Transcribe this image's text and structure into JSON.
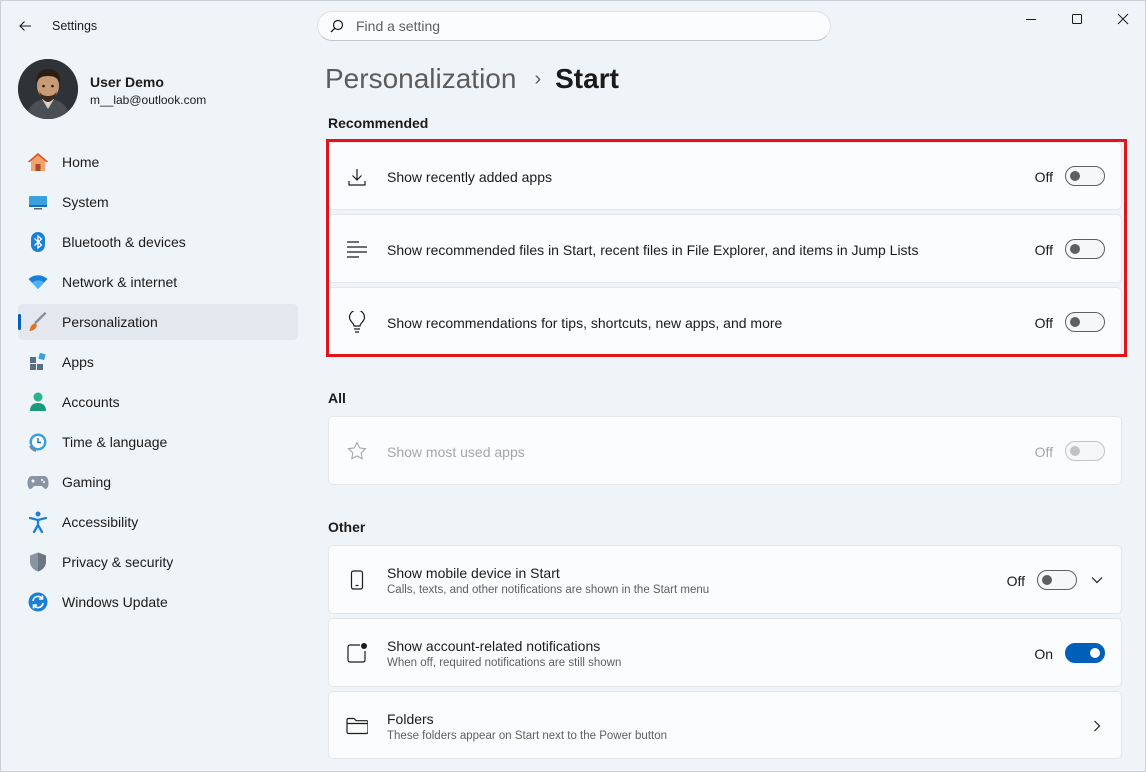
{
  "window": {
    "title": "Settings"
  },
  "search": {
    "placeholder": "Find a setting"
  },
  "user": {
    "name": "User Demo",
    "email": "m__lab@outlook.com"
  },
  "nav": [
    {
      "label": "Home",
      "icon": "home-icon"
    },
    {
      "label": "System",
      "icon": "system-icon"
    },
    {
      "label": "Bluetooth & devices",
      "icon": "bluetooth-icon"
    },
    {
      "label": "Network & internet",
      "icon": "wifi-icon"
    },
    {
      "label": "Personalization",
      "icon": "brush-icon",
      "selected": true
    },
    {
      "label": "Apps",
      "icon": "apps-icon"
    },
    {
      "label": "Accounts",
      "icon": "accounts-icon"
    },
    {
      "label": "Time & language",
      "icon": "time-icon"
    },
    {
      "label": "Gaming",
      "icon": "gamepad-icon"
    },
    {
      "label": "Accessibility",
      "icon": "accessibility-icon"
    },
    {
      "label": "Privacy & security",
      "icon": "shield-icon"
    },
    {
      "label": "Windows Update",
      "icon": "update-icon"
    }
  ],
  "breadcrumb": {
    "parent": "Personalization",
    "separator": "›",
    "current": "Start"
  },
  "sections": {
    "recommended": "Recommended",
    "all": "All",
    "other": "Other"
  },
  "recommended": [
    {
      "title": "Show recently added apps",
      "state": "Off",
      "on": false,
      "icon": "download-icon"
    },
    {
      "title": "Show recommended files in Start, recent files in File Explorer, and items in Jump Lists",
      "state": "Off",
      "on": false,
      "icon": "list-icon"
    },
    {
      "title": "Show recommendations for tips, shortcuts, new apps, and more",
      "state": "Off",
      "on": false,
      "icon": "lightbulb-icon"
    }
  ],
  "all": [
    {
      "title": "Show most used apps",
      "state": "Off",
      "on": false,
      "disabled": true,
      "icon": "star-icon"
    }
  ],
  "other": [
    {
      "title": "Show mobile device in Start",
      "desc": "Calls, texts, and other notifications are shown in the Start menu",
      "state": "Off",
      "on": false,
      "icon": "phone-icon"
    },
    {
      "title": "Show account-related notifications",
      "desc": "When off, required notifications are still shown",
      "state": "On",
      "on": true,
      "icon": "notification-icon"
    },
    {
      "title": "Folders",
      "desc": "These folders appear on Start next to the Power button",
      "icon": "folder-icon"
    }
  ],
  "colors": {
    "accent": "#005fb8",
    "highlight": "#e3131b",
    "background": "#eff4f9"
  }
}
